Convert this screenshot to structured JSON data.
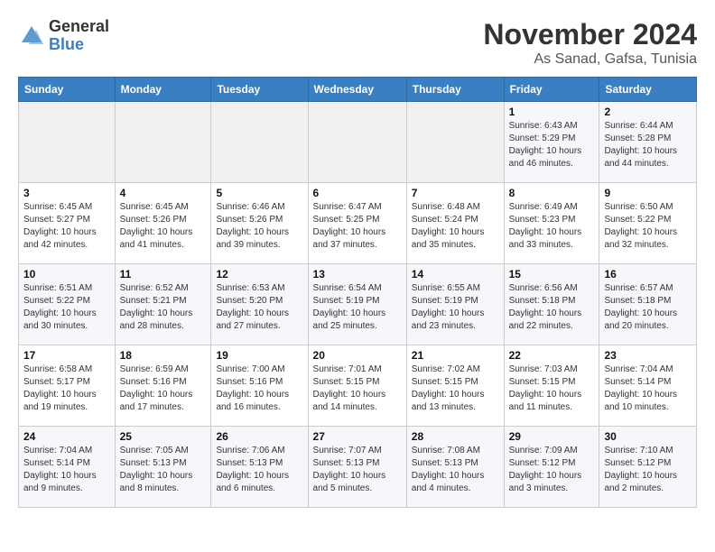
{
  "header": {
    "logo_line1": "General",
    "logo_line2": "Blue",
    "title": "November 2024",
    "subtitle": "As Sanad, Gafsa, Tunisia"
  },
  "weekdays": [
    "Sunday",
    "Monday",
    "Tuesday",
    "Wednesday",
    "Thursday",
    "Friday",
    "Saturday"
  ],
  "weeks": [
    [
      {
        "day": "",
        "info": ""
      },
      {
        "day": "",
        "info": ""
      },
      {
        "day": "",
        "info": ""
      },
      {
        "day": "",
        "info": ""
      },
      {
        "day": "",
        "info": ""
      },
      {
        "day": "1",
        "info": "Sunrise: 6:43 AM\nSunset: 5:29 PM\nDaylight: 10 hours\nand 46 minutes."
      },
      {
        "day": "2",
        "info": "Sunrise: 6:44 AM\nSunset: 5:28 PM\nDaylight: 10 hours\nand 44 minutes."
      }
    ],
    [
      {
        "day": "3",
        "info": "Sunrise: 6:45 AM\nSunset: 5:27 PM\nDaylight: 10 hours\nand 42 minutes."
      },
      {
        "day": "4",
        "info": "Sunrise: 6:45 AM\nSunset: 5:26 PM\nDaylight: 10 hours\nand 41 minutes."
      },
      {
        "day": "5",
        "info": "Sunrise: 6:46 AM\nSunset: 5:26 PM\nDaylight: 10 hours\nand 39 minutes."
      },
      {
        "day": "6",
        "info": "Sunrise: 6:47 AM\nSunset: 5:25 PM\nDaylight: 10 hours\nand 37 minutes."
      },
      {
        "day": "7",
        "info": "Sunrise: 6:48 AM\nSunset: 5:24 PM\nDaylight: 10 hours\nand 35 minutes."
      },
      {
        "day": "8",
        "info": "Sunrise: 6:49 AM\nSunset: 5:23 PM\nDaylight: 10 hours\nand 33 minutes."
      },
      {
        "day": "9",
        "info": "Sunrise: 6:50 AM\nSunset: 5:22 PM\nDaylight: 10 hours\nand 32 minutes."
      }
    ],
    [
      {
        "day": "10",
        "info": "Sunrise: 6:51 AM\nSunset: 5:22 PM\nDaylight: 10 hours\nand 30 minutes."
      },
      {
        "day": "11",
        "info": "Sunrise: 6:52 AM\nSunset: 5:21 PM\nDaylight: 10 hours\nand 28 minutes."
      },
      {
        "day": "12",
        "info": "Sunrise: 6:53 AM\nSunset: 5:20 PM\nDaylight: 10 hours\nand 27 minutes."
      },
      {
        "day": "13",
        "info": "Sunrise: 6:54 AM\nSunset: 5:19 PM\nDaylight: 10 hours\nand 25 minutes."
      },
      {
        "day": "14",
        "info": "Sunrise: 6:55 AM\nSunset: 5:19 PM\nDaylight: 10 hours\nand 23 minutes."
      },
      {
        "day": "15",
        "info": "Sunrise: 6:56 AM\nSunset: 5:18 PM\nDaylight: 10 hours\nand 22 minutes."
      },
      {
        "day": "16",
        "info": "Sunrise: 6:57 AM\nSunset: 5:18 PM\nDaylight: 10 hours\nand 20 minutes."
      }
    ],
    [
      {
        "day": "17",
        "info": "Sunrise: 6:58 AM\nSunset: 5:17 PM\nDaylight: 10 hours\nand 19 minutes."
      },
      {
        "day": "18",
        "info": "Sunrise: 6:59 AM\nSunset: 5:16 PM\nDaylight: 10 hours\nand 17 minutes."
      },
      {
        "day": "19",
        "info": "Sunrise: 7:00 AM\nSunset: 5:16 PM\nDaylight: 10 hours\nand 16 minutes."
      },
      {
        "day": "20",
        "info": "Sunrise: 7:01 AM\nSunset: 5:15 PM\nDaylight: 10 hours\nand 14 minutes."
      },
      {
        "day": "21",
        "info": "Sunrise: 7:02 AM\nSunset: 5:15 PM\nDaylight: 10 hours\nand 13 minutes."
      },
      {
        "day": "22",
        "info": "Sunrise: 7:03 AM\nSunset: 5:15 PM\nDaylight: 10 hours\nand 11 minutes."
      },
      {
        "day": "23",
        "info": "Sunrise: 7:04 AM\nSunset: 5:14 PM\nDaylight: 10 hours\nand 10 minutes."
      }
    ],
    [
      {
        "day": "24",
        "info": "Sunrise: 7:04 AM\nSunset: 5:14 PM\nDaylight: 10 hours\nand 9 minutes."
      },
      {
        "day": "25",
        "info": "Sunrise: 7:05 AM\nSunset: 5:13 PM\nDaylight: 10 hours\nand 8 minutes."
      },
      {
        "day": "26",
        "info": "Sunrise: 7:06 AM\nSunset: 5:13 PM\nDaylight: 10 hours\nand 6 minutes."
      },
      {
        "day": "27",
        "info": "Sunrise: 7:07 AM\nSunset: 5:13 PM\nDaylight: 10 hours\nand 5 minutes."
      },
      {
        "day": "28",
        "info": "Sunrise: 7:08 AM\nSunset: 5:13 PM\nDaylight: 10 hours\nand 4 minutes."
      },
      {
        "day": "29",
        "info": "Sunrise: 7:09 AM\nSunset: 5:12 PM\nDaylight: 10 hours\nand 3 minutes."
      },
      {
        "day": "30",
        "info": "Sunrise: 7:10 AM\nSunset: 5:12 PM\nDaylight: 10 hours\nand 2 minutes."
      }
    ]
  ]
}
